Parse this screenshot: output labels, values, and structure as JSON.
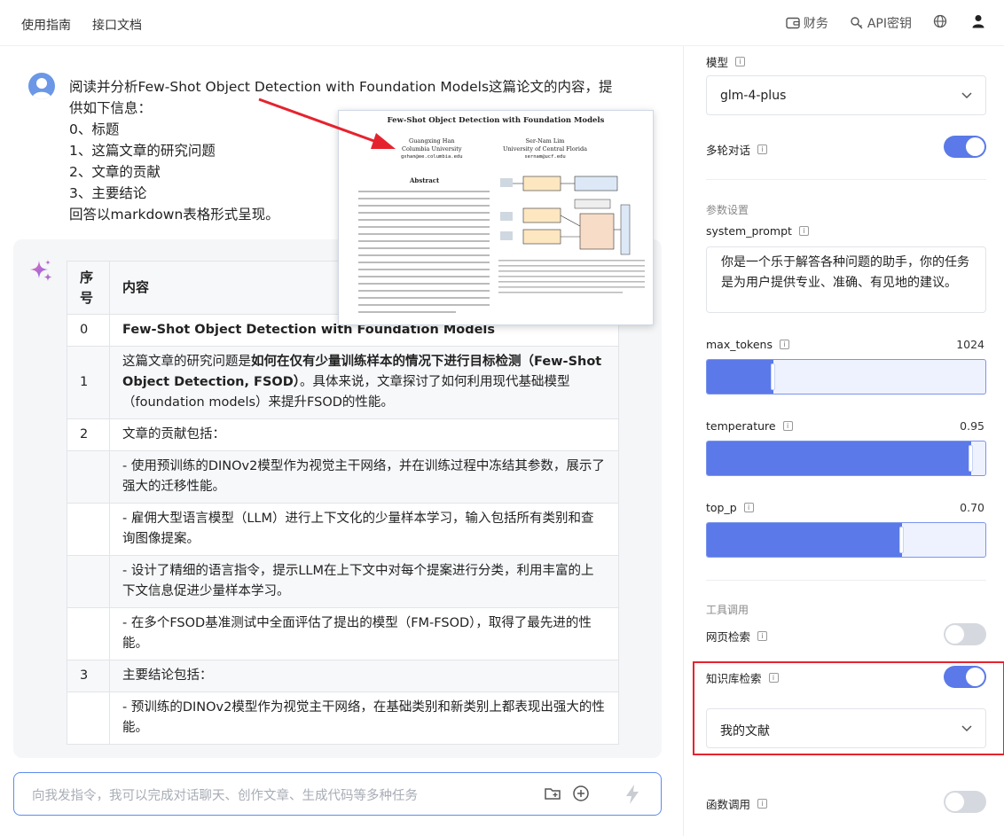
{
  "topbar": {
    "nav": [
      "使用指南",
      "接口文档"
    ],
    "finance_label": "财务",
    "api_key_label": "API密钥"
  },
  "user_message": {
    "lines": [
      "阅读并分析Few-Shot Object Detection with Foundation Models这篇论文的内容，提",
      "供如下信息：",
      "0、标题",
      "1、这篇文章的研究问题",
      "2、文章的贡献",
      "3、主要结论",
      "回答以markdown表格形式呈现。"
    ]
  },
  "paper_thumbnail": {
    "title": "Few-Shot Object Detection with Foundation Models",
    "author1": "Guangxing Han",
    "affil1": "Columbia University",
    "email1": "gxhan@ee.columbia.edu",
    "author2": "Ser-Nam Lim",
    "affil2": "University of Central Florida",
    "email2": "sernam@ucf.edu",
    "abstract_label": "Abstract"
  },
  "answer_table": {
    "headers": [
      "序号",
      "内容"
    ],
    "rows": [
      {
        "num": "0",
        "text": "Few-Shot Object Detection with Foundation Models",
        "bold": true
      },
      {
        "num": "1",
        "pre": "这篇文章的研究问题是",
        "strong": "如何在仅有少量训练样本的情况下进行目标检测（Few-Shot Object Detection, FSOD）",
        "post": "。具体来说，文章探讨了如何利用现代基础模型（foundation models）来提升FSOD的性能。"
      },
      {
        "num": "2",
        "text": "文章的贡献包括："
      },
      {
        "num": "",
        "text": "- 使用预训练的DINOv2模型作为视觉主干网络，并在训练过程中冻结其参数，展示了强大的迁移性能。"
      },
      {
        "num": "",
        "text": "- 雇佣大型语言模型（LLM）进行上下文化的少量样本学习，输入包括所有类别和查询图像提案。"
      },
      {
        "num": "",
        "text": "- 设计了精细的语言指令，提示LLM在上下文中对每个提案进行分类，利用丰富的上下文信息促进少量样本学习。"
      },
      {
        "num": "",
        "text": "- 在多个FSOD基准测试中全面评估了提出的模型（FM-FSOD），取得了最先进的性能。"
      },
      {
        "num": "3",
        "text": "主要结论包括："
      },
      {
        "num": "",
        "text": "- 预训练的DINOv2模型作为视觉主干网络，在基础类别和新类别上都表现出强大的性能。"
      }
    ]
  },
  "input": {
    "placeholder": "向我发指令，我可以完成对话聊天、创作文章、生成代码等多种任务"
  },
  "panel": {
    "model_label": "模型",
    "model_value": "glm-4-plus",
    "multi_turn_label": "多轮对话",
    "multi_turn_on": true,
    "params_section": "参数设置",
    "system_prompt_label": "system_prompt",
    "system_prompt_value": "你是一个乐于解答各种问题的助手，你的任务是为用户提供专业、准确、有见地的建议。",
    "max_tokens_label": "max_tokens",
    "max_tokens_value": "1024",
    "max_tokens_fraction": 0.24,
    "temperature_label": "temperature",
    "temperature_value": "0.95",
    "temperature_fraction": 0.95,
    "top_p_label": "top_p",
    "top_p_value": "0.70",
    "top_p_fraction": 0.7,
    "tools_section": "工具调用",
    "web_search_label": "网页检索",
    "web_search_on": false,
    "kb_search_label": "知识库检索",
    "kb_search_on": true,
    "kb_value": "我的文献",
    "function_call_label": "函数调用",
    "function_call_on": false
  },
  "colors": {
    "accent": "#5b79e8",
    "highlight_box": "#e5232e",
    "arrow": "#e5232e"
  }
}
